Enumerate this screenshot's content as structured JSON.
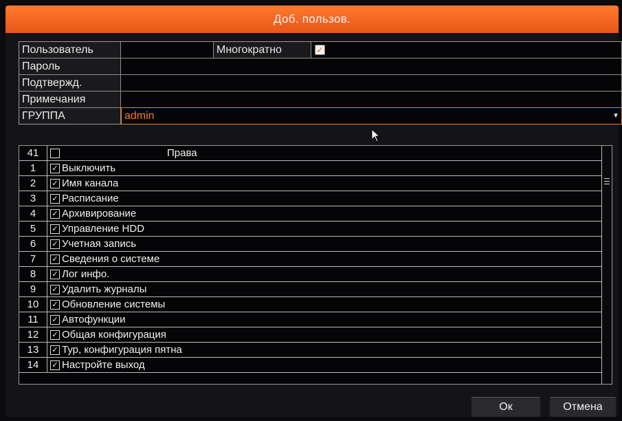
{
  "dialog": {
    "title": "Доб. пользов."
  },
  "form": {
    "user_label": "Пользователь",
    "user_value": "",
    "multi_label": "Многократно",
    "multi_checked": true,
    "password_label": "Пароль",
    "confirm_label": "Подтвержд.",
    "notes_label": "Примечания",
    "group_label": "ГРУППА",
    "group_value": "admin"
  },
  "rights": {
    "header_count": "41",
    "header_title": "Права",
    "items": [
      {
        "num": "1",
        "label": "Выключить"
      },
      {
        "num": "2",
        "label": "Имя канала"
      },
      {
        "num": "3",
        "label": "Расписание"
      },
      {
        "num": "4",
        "label": "Архивирование"
      },
      {
        "num": "5",
        "label": "Управление HDD"
      },
      {
        "num": "6",
        "label": "Учетная запись"
      },
      {
        "num": "7",
        "label": "Сведения о системе"
      },
      {
        "num": "8",
        "label": "Лог инфо."
      },
      {
        "num": "9",
        "label": "Удалить журналы"
      },
      {
        "num": "10",
        "label": "Обновление системы"
      },
      {
        "num": "11",
        "label": "Автофункции"
      },
      {
        "num": "12",
        "label": "Общая конфигурация"
      },
      {
        "num": "13",
        "label": "Тур, конфигурация пятна"
      },
      {
        "num": "14",
        "label": "Настройте выход"
      }
    ]
  },
  "buttons": {
    "ok": "Ок",
    "cancel": "Отмена"
  },
  "colors": {
    "accent": "#f07a2c",
    "titlebar": "#ee6420"
  }
}
